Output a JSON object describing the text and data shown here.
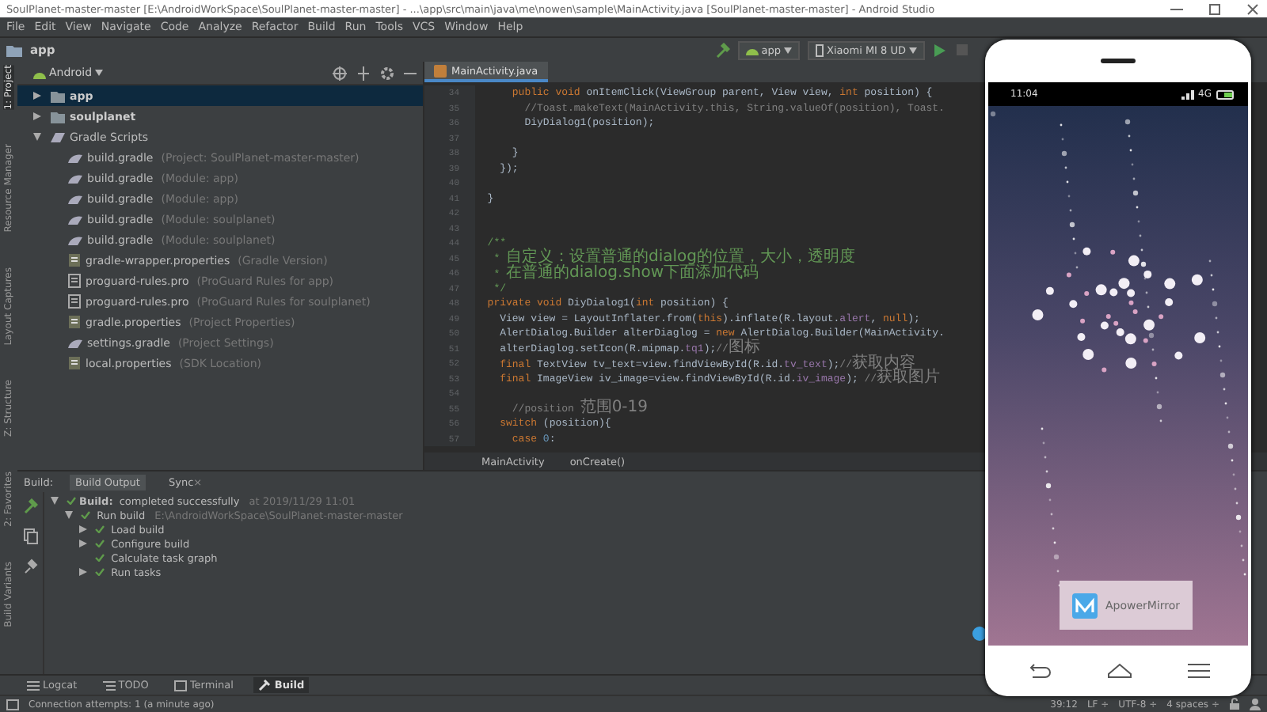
{
  "window": {
    "title": "SoulPlanet-master-master [E:\\AndroidWorkSpace\\SoulPlanet-master-master] - ...\\app\\src\\main\\java\\me\\nowen\\sample\\MainActivity.java [SoulPlanet-master-master] - Android Studio"
  },
  "menu": [
    "File",
    "Edit",
    "View",
    "Navigate",
    "Code",
    "Analyze",
    "Refactor",
    "Build",
    "Run",
    "Tools",
    "VCS",
    "Window",
    "Help"
  ],
  "navbar": {
    "path": "app",
    "run_config": "app",
    "device": "Xiaomi MI 8 UD"
  },
  "tool_strip": [
    {
      "label": "1: Project",
      "selected": true
    },
    {
      "label": "Resource Manager",
      "selected": false
    },
    {
      "label": "Layout Captures",
      "selected": false
    },
    {
      "label": "Z: Structure",
      "selected": false
    },
    {
      "label": "2: Favorites",
      "selected": false
    },
    {
      "label": "Build Variants",
      "selected": false
    }
  ],
  "project": {
    "view": "Android",
    "items": [
      {
        "label": "app",
        "kind": "module",
        "expanded": false,
        "selected": true
      },
      {
        "label": "soulplanet",
        "kind": "module",
        "expanded": false,
        "selected": false
      },
      {
        "label": "Gradle Scripts",
        "kind": "gradle-folder",
        "expanded": true,
        "selected": false,
        "children": [
          {
            "label": "build.gradle",
            "hint": "(Project: SoulPlanet-master-master)",
            "kind": "gradle",
            "selected": false
          },
          {
            "label": "build.gradle",
            "hint": "(Module: app)",
            "kind": "gradle",
            "selected": false
          },
          {
            "label": "build.gradle",
            "hint": "(Module: app)",
            "kind": "gradle",
            "selected": false
          },
          {
            "label": "build.gradle",
            "hint": "(Module: soulplanet)",
            "kind": "gradle",
            "selected": false
          },
          {
            "label": "build.gradle",
            "hint": "(Module: soulplanet)",
            "kind": "gradle",
            "selected": false
          },
          {
            "label": "gradle-wrapper.properties",
            "hint": "(Gradle Version)",
            "kind": "properties",
            "selected": false
          },
          {
            "label": "proguard-rules.pro",
            "hint": "(ProGuard Rules for app)",
            "kind": "text",
            "selected": false
          },
          {
            "label": "proguard-rules.pro",
            "hint": "(ProGuard Rules for soulplanet)",
            "kind": "text",
            "selected": false
          },
          {
            "label": "gradle.properties",
            "hint": "(Project Properties)",
            "kind": "properties",
            "selected": false
          },
          {
            "label": "settings.gradle",
            "hint": "(Project Settings)",
            "kind": "gradle",
            "selected": false
          },
          {
            "label": "local.properties",
            "hint": "(SDK Location)",
            "kind": "properties",
            "selected": false
          }
        ]
      }
    ]
  },
  "editor": {
    "tabs": [
      {
        "label": "MainActivity.java",
        "selected": true
      }
    ],
    "lines": [
      {
        "number": "34",
        "parts": [
          {
            "kind": "kw",
            "text": "      public void "
          },
          {
            "kind": "code",
            "text": "onItemClick(ViewGroup parent, View view, "
          },
          {
            "kind": "kw",
            "text": "int "
          },
          {
            "kind": "code",
            "text": "position) {"
          }
        ]
      },
      {
        "number": "35",
        "parts": [
          {
            "kind": "comment",
            "text": "        //Toast.makeText(MainActivity.this, String.valueOf(position), Toast."
          }
        ]
      },
      {
        "number": "36",
        "parts": [
          {
            "kind": "code",
            "text": "        DiyDialog1(position);"
          }
        ]
      },
      {
        "number": "37"
      },
      {
        "number": "38",
        "parts": [
          {
            "kind": "code",
            "text": "      }"
          }
        ]
      },
      {
        "number": "39",
        "parts": [
          {
            "kind": "code",
            "text": "    });"
          }
        ]
      },
      {
        "number": "40"
      },
      {
        "number": "41",
        "parts": [
          {
            "kind": "code",
            "text": "  }"
          }
        ]
      },
      {
        "number": "42"
      },
      {
        "number": "43"
      },
      {
        "number": "44",
        "parts": [
          {
            "kind": "doc",
            "text": "  /**"
          }
        ]
      },
      {
        "number": "45",
        "parts": [
          {
            "kind": "doc",
            "text": "   * "
          },
          {
            "kind": "docnote",
            "text": "自定义：设置普通的dialog的位置，大小，透明度"
          }
        ]
      },
      {
        "number": "46",
        "parts": [
          {
            "kind": "doc",
            "text": "   * "
          },
          {
            "kind": "docnote",
            "text": "在普通的dialog.show下面添加代码"
          }
        ]
      },
      {
        "number": "47",
        "parts": [
          {
            "kind": "doc",
            "text": "   */"
          }
        ]
      },
      {
        "number": "48",
        "parts": [
          {
            "kind": "kw",
            "text": "  private void "
          },
          {
            "kind": "code",
            "text": "DiyDialog1("
          },
          {
            "kind": "kw",
            "text": "int "
          },
          {
            "kind": "code",
            "text": "position) {"
          }
        ]
      },
      {
        "number": "49",
        "parts": [
          {
            "kind": "code",
            "text": "    View view = LayoutInflater.from("
          },
          {
            "kind": "kw",
            "text": "this"
          },
          {
            "kind": "code",
            "text": ").inflate(R.layout."
          },
          {
            "kind": "field",
            "text": "alert"
          },
          {
            "kind": "code",
            "text": ", "
          },
          {
            "kind": "kw",
            "text": "null"
          },
          {
            "kind": "code",
            "text": ");"
          }
        ]
      },
      {
        "number": "50",
        "parts": [
          {
            "kind": "code",
            "text": "    AlertDialog.Builder alterDiaglog = "
          },
          {
            "kind": "kw",
            "text": "new "
          },
          {
            "kind": "code",
            "text": "AlertDialog.Builder(MainActivity."
          }
        ]
      },
      {
        "number": "51",
        "parts": [
          {
            "kind": "code",
            "text": "    alterDiaglog.setIcon(R.mipmap."
          },
          {
            "kind": "field",
            "text": "tq1"
          },
          {
            "kind": "code",
            "text": ");"
          },
          {
            "kind": "comment",
            "text": "//"
          },
          {
            "kind": "note",
            "text": "图标"
          }
        ]
      },
      {
        "number": "52",
        "parts": [
          {
            "kind": "kw",
            "text": "    final "
          },
          {
            "kind": "code",
            "text": "TextView tv_text=view.findViewById(R.id."
          },
          {
            "kind": "field",
            "text": "tv_text"
          },
          {
            "kind": "code",
            "text": ");"
          },
          {
            "kind": "comment",
            "text": "//"
          },
          {
            "kind": "note",
            "text": "获取内容"
          }
        ]
      },
      {
        "number": "53",
        "parts": [
          {
            "kind": "kw",
            "text": "    final "
          },
          {
            "kind": "code",
            "text": "ImageView iv_image=view.findViewById(R.id."
          },
          {
            "kind": "field",
            "text": "iv_image"
          },
          {
            "kind": "code",
            "text": "); "
          },
          {
            "kind": "comment",
            "text": "//"
          },
          {
            "kind": "note",
            "text": "获取图片"
          }
        ]
      },
      {
        "number": "54"
      },
      {
        "number": "55",
        "parts": [
          {
            "kind": "comment",
            "text": "      //position "
          },
          {
            "kind": "note",
            "text": "范围0-19"
          }
        ]
      },
      {
        "number": "56",
        "parts": [
          {
            "kind": "kw",
            "text": "    switch "
          },
          {
            "kind": "code",
            "text": "(position){"
          }
        ]
      },
      {
        "number": "57",
        "parts": [
          {
            "kind": "kw",
            "text": "      case "
          },
          {
            "kind": "num",
            "text": "0"
          },
          {
            "kind": "code",
            "text": ":"
          }
        ]
      }
    ],
    "breadcrumb": [
      "MainActivity",
      "onCreate()"
    ]
  },
  "build": {
    "label": "Build:",
    "tabs": [
      {
        "label": "Build Output",
        "selected": true
      },
      {
        "label": "Sync",
        "selected": false,
        "close": "×"
      }
    ],
    "tree": [
      {
        "label": "Build:",
        "rest": " completed successfully",
        "hint": "at 2019/11/29 11:01",
        "expanded": true,
        "children": [
          {
            "label": "Run build",
            "hint": "E:\\AndroidWorkSpace\\SoulPlanet-master-master",
            "expanded": true,
            "children": [
              {
                "label": "Load build",
                "expanded": false
              },
              {
                "label": "Configure build",
                "expanded": false
              },
              {
                "label": "Calculate task graph"
              },
              {
                "label": "Run tasks",
                "expanded": false
              }
            ]
          }
        ]
      }
    ]
  },
  "bottom_tabs": [
    {
      "label": "Logcat",
      "kind": "logcat",
      "selected": false
    },
    {
      "label": "TODO",
      "kind": "todo",
      "selected": false
    },
    {
      "label": "Terminal",
      "kind": "terminal",
      "selected": false
    },
    {
      "label": "Build",
      "kind": "build",
      "selected": true
    }
  ],
  "status": {
    "message": "Connection attempts: 1 (a minute ago)",
    "items": [
      "39:12",
      "LF ÷",
      "UTF-8 ÷",
      "4 spaces ÷"
    ]
  },
  "phone": {
    "time": "11:04",
    "network": "4G",
    "toast": "ApowerMirror"
  }
}
